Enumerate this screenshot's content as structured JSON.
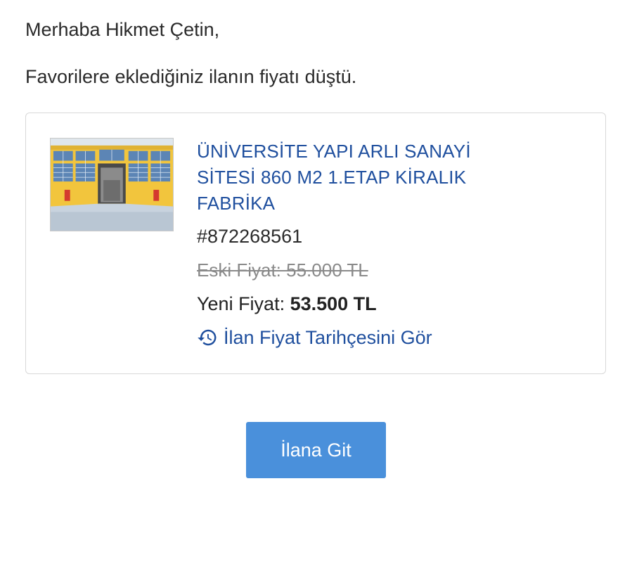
{
  "greeting": "Merhaba Hikmet Çetin,",
  "intro": "Favorilere eklediğiniz ilanın fiyatı düştü.",
  "listing": {
    "title_lines": [
      "ÜNİVERSİTE YAPI ARLI SANAYİ",
      "SİTESİ 860 M2 1.ETAP KİRALIK",
      "FABRİKA"
    ],
    "ad_number": "#872268561",
    "old_price": "Eski Fiyat: 55.000 TL",
    "new_price_label": "Yeni Fiyat: ",
    "new_price_value": "53.500 TL",
    "history_link": "İlan Fiyat Tarihçesini Gör",
    "history_icon": "history-icon"
  },
  "cta_label": "İlana Git",
  "colors": {
    "link": "#1f4f9e",
    "button": "#4a90db",
    "building_wall": "#f2c53d"
  }
}
